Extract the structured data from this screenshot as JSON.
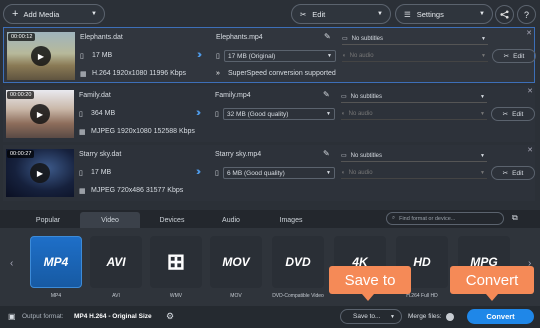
{
  "toolbar": {
    "add_media": "Add Media",
    "edit": "Edit",
    "settings": "Settings"
  },
  "files": [
    {
      "duration": "00:00:12",
      "src_name": "Elephants.dat",
      "src_size": "17 MB",
      "src_codec": "H.264 1920x1080 11996 Kbps",
      "out_name": "Elephants.mp4",
      "out_quality": "17 MB (Original)",
      "subtitles": "No subtitles",
      "audio": "No audio",
      "edit_label": "Edit",
      "note": "SuperSpeed conversion supported"
    },
    {
      "duration": "00:00:20",
      "src_name": "Family.dat",
      "src_size": "364 MB",
      "src_codec": "MJPEG 1920x1080 152588 Kbps",
      "out_name": "Family.mp4",
      "out_quality": "32 MB (Good quality)",
      "subtitles": "No subtitles",
      "audio": "No audio",
      "edit_label": "Edit"
    },
    {
      "duration": "00:00:27",
      "src_name": "Starry sky.dat",
      "src_size": "17 MB",
      "src_codec": "MJPEG 720x486 31577 Kbps",
      "out_name": "Starry sky.mp4",
      "out_quality": "6 MB (Good quality)",
      "subtitles": "No subtitles",
      "audio": "No audio",
      "edit_label": "Edit"
    }
  ],
  "tabs": [
    "Popular",
    "Video",
    "Devices",
    "Audio",
    "Images"
  ],
  "search_placeholder": "Find format or device...",
  "formats": [
    {
      "logo": "MP4",
      "label": "MP4"
    },
    {
      "logo": "AVI",
      "label": "AVI"
    },
    {
      "logo": "WMV",
      "label": "WMV"
    },
    {
      "logo": "MOV",
      "label": "MOV"
    },
    {
      "logo": "DVD",
      "label": "DVD-Compatible Video"
    },
    {
      "logo": "4K",
      "label": ""
    },
    {
      "logo": "HD",
      "label": "H.264 Full HD"
    },
    {
      "logo": "MPG",
      "label": "MPEG"
    }
  ],
  "footer": {
    "output_label": "Output format:",
    "output_value": "MP4 H.264 - Original Size",
    "save_to": "Save to...",
    "merge": "Merge files:",
    "convert": "Convert"
  },
  "callouts": {
    "save_to": "Save to",
    "convert": "Convert"
  }
}
